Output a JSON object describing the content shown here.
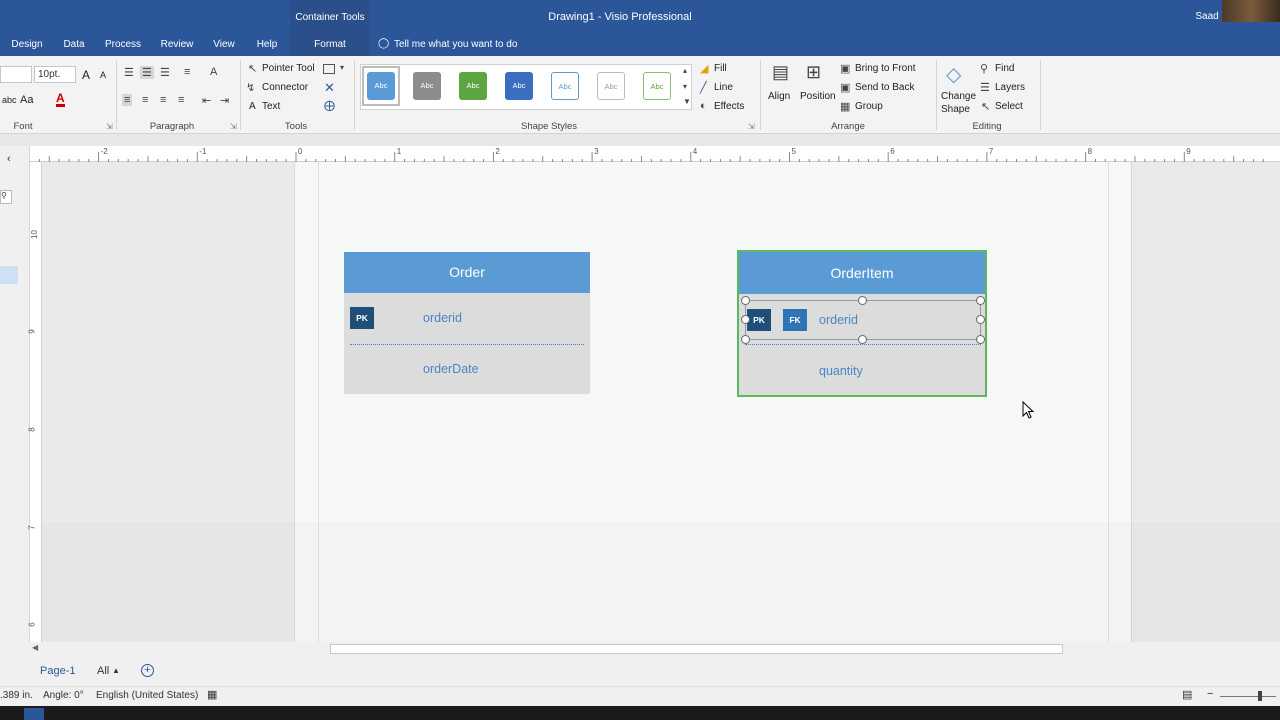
{
  "window": {
    "title": "Drawing1  -  Visio Professional",
    "context_tab_group": "Container Tools",
    "user": "Saad Y"
  },
  "tabs": [
    "Design",
    "Data",
    "Process",
    "Review",
    "View",
    "Help",
    "Format"
  ],
  "active_tab": "Format",
  "tell_me": "Tell me what you want to do",
  "ribbon": {
    "font": {
      "size": "10pt.",
      "label": "Font",
      "grow": "A",
      "shrink": "A",
      "case": "Aa",
      "color_letter": "A",
      "strike": "abc"
    },
    "paragraph": {
      "label": "Paragraph"
    },
    "tools": {
      "pointer": "Pointer Tool",
      "connector": "Connector",
      "text": "Text",
      "text_glyph": "A",
      "label": "Tools"
    },
    "shape_styles": {
      "sample": "Abc",
      "label": "Shape Styles",
      "fill": "Fill",
      "line": "Line",
      "effects": "Effects"
    },
    "arrange": {
      "align": "Align",
      "position": "Position",
      "bring_front": "Bring to Front",
      "send_back": "Send to Back",
      "group": "Group",
      "label": "Arrange"
    },
    "editing": {
      "change_shape_1": "Change",
      "change_shape_2": "Shape",
      "find": "Find",
      "layers": "Layers",
      "select": "Select",
      "label": "Editing"
    }
  },
  "ruler": {
    "top": [
      "-2",
      "-1",
      "0",
      "1",
      "2",
      "3",
      "4",
      "5",
      "6",
      "7",
      "8",
      "9"
    ],
    "left": [
      "10",
      "9",
      "8",
      "7",
      "6"
    ]
  },
  "entities": {
    "order": {
      "title": "Order",
      "pk": "PK",
      "fields": [
        "orderid",
        "orderDate"
      ]
    },
    "orderitem": {
      "title": "OrderItem",
      "pk": "PK",
      "fk": "FK",
      "fields": [
        "orderid",
        "quantity"
      ]
    }
  },
  "pages": {
    "current": "Page-1",
    "all": "All"
  },
  "status": {
    "width": ".389 in.",
    "angle": "Angle: 0°",
    "language": "English (United States)"
  },
  "colors": {
    "ribbon_blue": "#2b579a",
    "entity_header": "#5b9bd5",
    "entity_body": "#dcdcdc",
    "pk": "#1f4e79",
    "fk": "#2e75b6",
    "selection": "#5cb85c"
  }
}
